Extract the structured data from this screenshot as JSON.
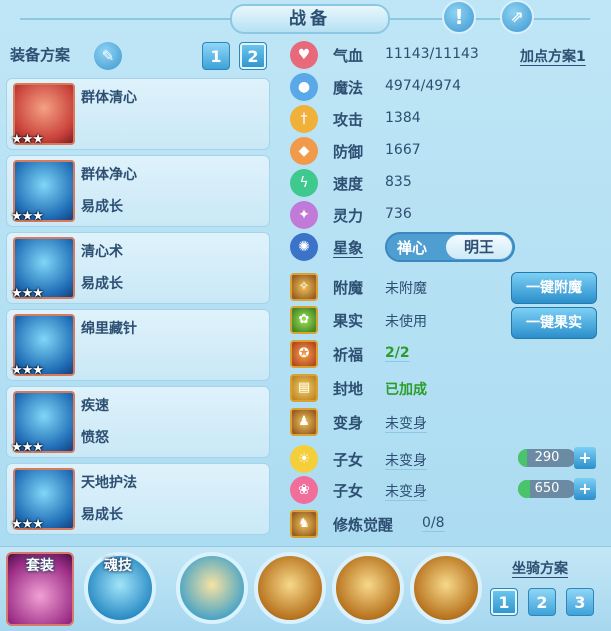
{
  "header": {
    "title": "战备",
    "info_icon": "exclamation-icon",
    "share_icon": "share-icon"
  },
  "equipment": {
    "label": "装备方案",
    "edit_icon": "pencil-icon",
    "tabs": [
      "1",
      "2"
    ],
    "active_tab": "2"
  },
  "skills": [
    {
      "name": "群体清心",
      "sub": "",
      "stars": "★★★"
    },
    {
      "name": "群体净心",
      "sub": "易成长",
      "stars": "★★★"
    },
    {
      "name": "清心术",
      "sub": "易成长",
      "stars": "★★★"
    },
    {
      "name": "绵里藏针",
      "sub": "",
      "stars": "★★★"
    },
    {
      "name": "疾速",
      "sub": "愤怒",
      "stars": "★★★"
    },
    {
      "name": "天地护法",
      "sub": "易成长",
      "stars": "★★★"
    }
  ],
  "attributes": {
    "plan_link": "加点方案1",
    "stats": [
      {
        "label": "气血",
        "value": "11143/11143",
        "icon": "heart-icon",
        "color": "#e86a7a"
      },
      {
        "label": "魔法",
        "value": "4974/4974",
        "icon": "mana-icon",
        "color": "#5aa8e8"
      },
      {
        "label": "攻击",
        "value": "1384",
        "icon": "sword-icon",
        "color": "#f0b13a"
      },
      {
        "label": "防御",
        "value": "1667",
        "icon": "shield-icon",
        "color": "#f09a4a"
      },
      {
        "label": "速度",
        "value": "835",
        "icon": "lightning-icon",
        "color": "#3fc98f"
      },
      {
        "label": "灵力",
        "value": "736",
        "icon": "spirit-icon",
        "color": "#c27ad8"
      }
    ],
    "star_label": "星象",
    "star_options": [
      "禅心",
      "明王"
    ],
    "star_selected": "明王"
  },
  "buffs": [
    {
      "label": "附魔",
      "value": "未附魔",
      "icon": "enchant-icon"
    },
    {
      "label": "果实",
      "value": "未使用",
      "icon": "fruit-icon"
    },
    {
      "label": "祈福",
      "value": "2/2",
      "icon": "blessing-icon"
    },
    {
      "label": "封地",
      "value": "已加成",
      "icon": "fief-icon"
    },
    {
      "label": "变身",
      "value": "未变身",
      "icon": "transform-icon"
    },
    {
      "label": "子女",
      "value": "未变身",
      "icon": "child-sun-icon"
    },
    {
      "label": "子女",
      "value": "未变身",
      "icon": "child-pink-icon"
    },
    {
      "label": "修炼觉醒",
      "value": "0/8",
      "icon": "awaken-icon"
    }
  ],
  "actions": {
    "enchant_button": "一键附魔",
    "fruit_button": "一键果实"
  },
  "steppers": [
    {
      "value": "290",
      "fill": 0.15
    },
    {
      "value": "650",
      "fill": 0.2
    }
  ],
  "bottom": {
    "set_label": "套装",
    "soul_label": "魂技",
    "mount_label": "坐骑方案",
    "mount_tabs": [
      "1",
      "2",
      "3"
    ],
    "mount_active": "1"
  }
}
